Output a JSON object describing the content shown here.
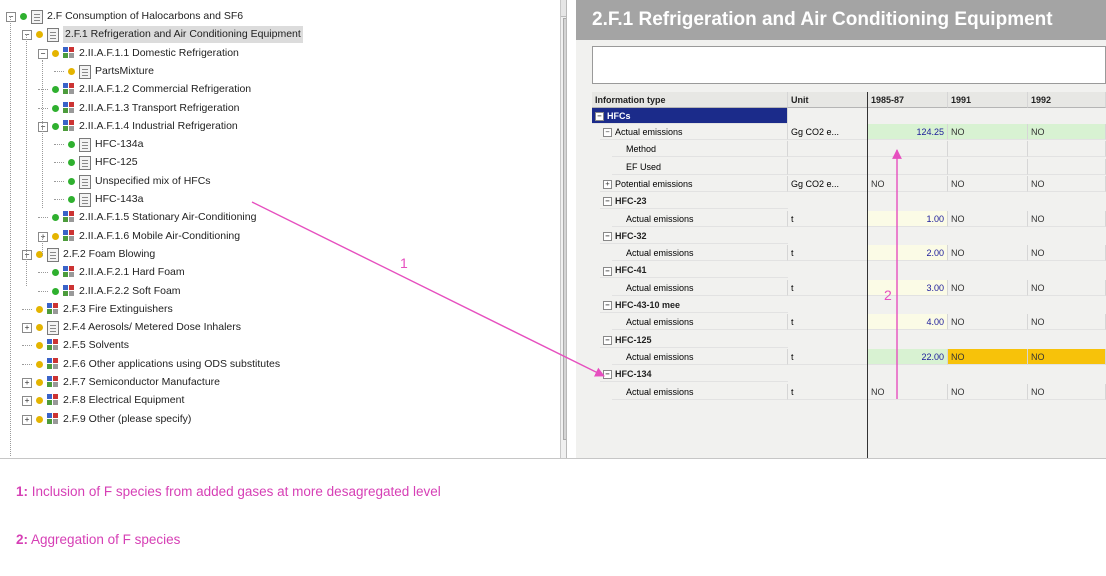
{
  "tree": {
    "items": [
      {
        "label": "2.F  Consumption of Halocarbons and SF6",
        "x": 0
      },
      {
        "label": "2.F.1  Refrigeration and Air Conditioning Equipment"
      },
      {
        "label": "2.II.A.F.1.1  Domestic Refrigeration"
      },
      {
        "label": "PartsMixture"
      },
      {
        "label": "2.II.A.F.1.2  Commercial Refrigeration"
      },
      {
        "label": "2.II.A.F.1.3  Transport Refrigeration"
      },
      {
        "label": "2.II.A.F.1.4  Industrial Refrigeration"
      },
      {
        "label": "HFC-134a"
      },
      {
        "label": "HFC-125"
      },
      {
        "label": "Unspecified mix of HFCs"
      },
      {
        "label": "HFC-143a"
      },
      {
        "label": "2.II.A.F.1.5  Stationary Air-Conditioning"
      },
      {
        "label": "2.II.A.F.1.6  Mobile Air-Conditioning"
      },
      {
        "label": "2.F.2  Foam Blowing"
      },
      {
        "label": "2.II.A.F.2.1  Hard Foam"
      },
      {
        "label": "2.II.A.F.2.2  Soft Foam"
      },
      {
        "label": "2.F.3  Fire Extinguishers"
      },
      {
        "label": "2.F.4  Aerosols/ Metered Dose Inhalers"
      },
      {
        "label": "2.F.5  Solvents"
      },
      {
        "label": "2.F.6  Other applications using ODS substitutes"
      },
      {
        "label": "2.F.7  Semiconductor Manufacture"
      },
      {
        "label": "2.F.8  Electrical Equipment"
      },
      {
        "label": "2.F.9  Other (please specify)"
      }
    ]
  },
  "panel": {
    "title": "2.F.1  Refrigeration and Air Conditioning Equipment",
    "columns": [
      "Information type",
      "Unit",
      "1985-87",
      "1991",
      "1992"
    ],
    "group": "HFCs",
    "rows": [
      {
        "label": "Actual emissions",
        "unit": "Gg CO2 e...",
        "base": "124.25",
        "y1991": "NO",
        "y1992": "NO"
      },
      {
        "label": "Method",
        "unit": "",
        "base": "",
        "y1991": "",
        "y1992": ""
      },
      {
        "label": "EF Used",
        "unit": "",
        "base": "",
        "y1991": "",
        "y1992": ""
      },
      {
        "label": "Potential emissions",
        "unit": "Gg CO2 e...",
        "base": "NO",
        "y1991": "NO",
        "y1992": "NO"
      },
      {
        "label": "HFC-23",
        "section": true
      },
      {
        "label": "Actual emissions",
        "unit": "t",
        "base": "1.00",
        "y1991": "NO",
        "y1992": "NO"
      },
      {
        "label": "HFC-32",
        "section": true
      },
      {
        "label": "Actual emissions",
        "unit": "t",
        "base": "2.00",
        "y1991": "NO",
        "y1992": "NO"
      },
      {
        "label": "HFC-41",
        "section": true
      },
      {
        "label": "Actual emissions",
        "unit": "t",
        "base": "3.00",
        "y1991": "NO",
        "y1992": "NO"
      },
      {
        "label": "HFC-43-10 mee",
        "section": true
      },
      {
        "label": "Actual emissions",
        "unit": "t",
        "base": "4.00",
        "y1991": "NO",
        "y1992": "NO"
      },
      {
        "label": "HFC-125",
        "section": true
      },
      {
        "label": "Actual emissions",
        "unit": "t",
        "base": "22.00",
        "y1991": "NO",
        "y1992": "NO"
      },
      {
        "label": "HFC-134",
        "section": true
      },
      {
        "label": "Actual emissions",
        "unit": "t",
        "base": "NO",
        "y1991": "NO",
        "y1992": "NO"
      }
    ]
  },
  "annotations": {
    "marker1": "1",
    "marker2": "2",
    "caption1_num": "1:",
    "caption1": "Inclusion of F species from added gases at more desagregated level",
    "caption2_num": "2:",
    "caption2": "Aggregation of F species"
  },
  "colors": {
    "annotation": "#e64fbf",
    "group_header": "#1b2b8a",
    "highlight_green": "#d8f2d2",
    "highlight_yellow": "#f7c20a"
  }
}
